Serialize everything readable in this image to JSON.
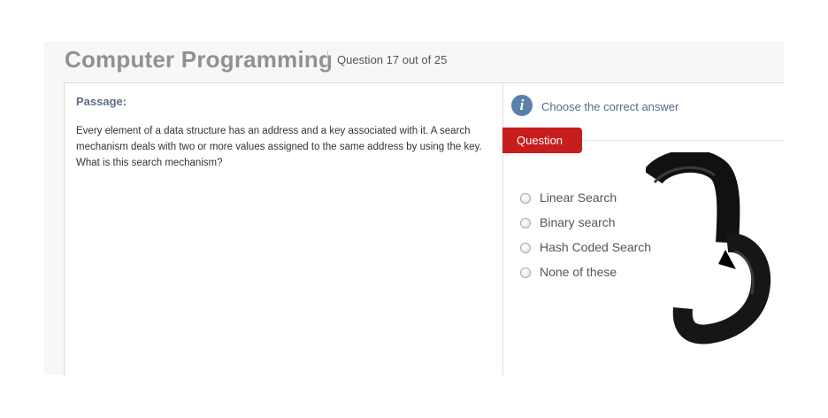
{
  "header": {
    "title": "Computer Programming",
    "question_counter": "Question 17 out of 25"
  },
  "passage": {
    "heading": "Passage:",
    "text": "Every element of a data structure has an address and a key associated with it. A search mechanism deals with two or more values assigned to the same address by using the key. What is this search mechanism?"
  },
  "question_panel": {
    "info_icon": "info-icon",
    "instruction": "Choose the correct answer",
    "tab_label": "Question",
    "tab_color": "#c81d1d",
    "options": [
      "Linear Search",
      "Binary search",
      "Hash Coded Search",
      "None of these"
    ]
  },
  "annotation": {
    "icon": "hand-drawn-scribble",
    "color": "#111111"
  }
}
